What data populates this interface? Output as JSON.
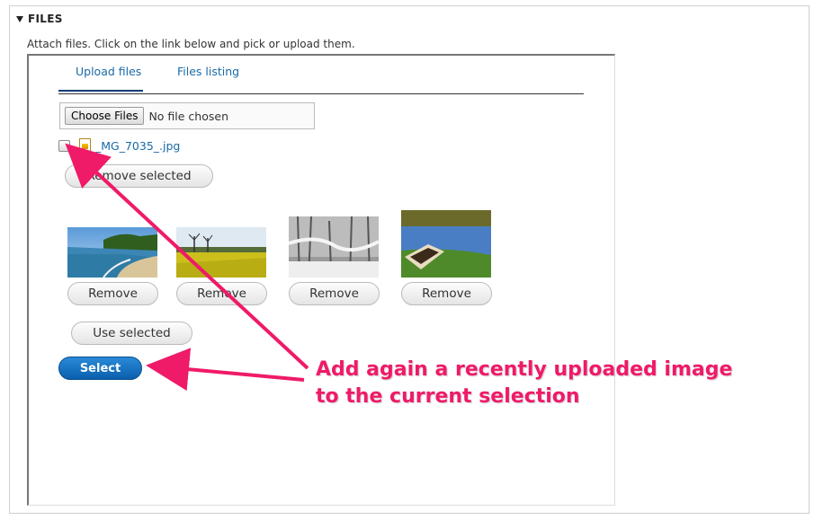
{
  "fieldset": {
    "legend": "FILES",
    "description": "Attach files. Click on the link below and pick or upload them."
  },
  "tabs": [
    {
      "label": "Upload files",
      "active": true
    },
    {
      "label": "Files listing",
      "active": false
    }
  ],
  "upload": {
    "choose_label": "Choose Files",
    "status": "No file chosen"
  },
  "recent_file": {
    "name": "_MG_7035_.jpg",
    "checked": false
  },
  "buttons": {
    "remove_selected": "Remove selected",
    "remove": "Remove",
    "use_selected": "Use selected",
    "select": "Select"
  },
  "thumbnails": [
    {
      "icon": "beach-image"
    },
    {
      "icon": "rapeseed-field-image"
    },
    {
      "icon": "snowy-forest-image"
    },
    {
      "icon": "boat-lake-image"
    }
  ],
  "annotation": {
    "line1": "Add again a recently uploaded image",
    "line2": "to the current selection",
    "color": "#ef1a68"
  }
}
